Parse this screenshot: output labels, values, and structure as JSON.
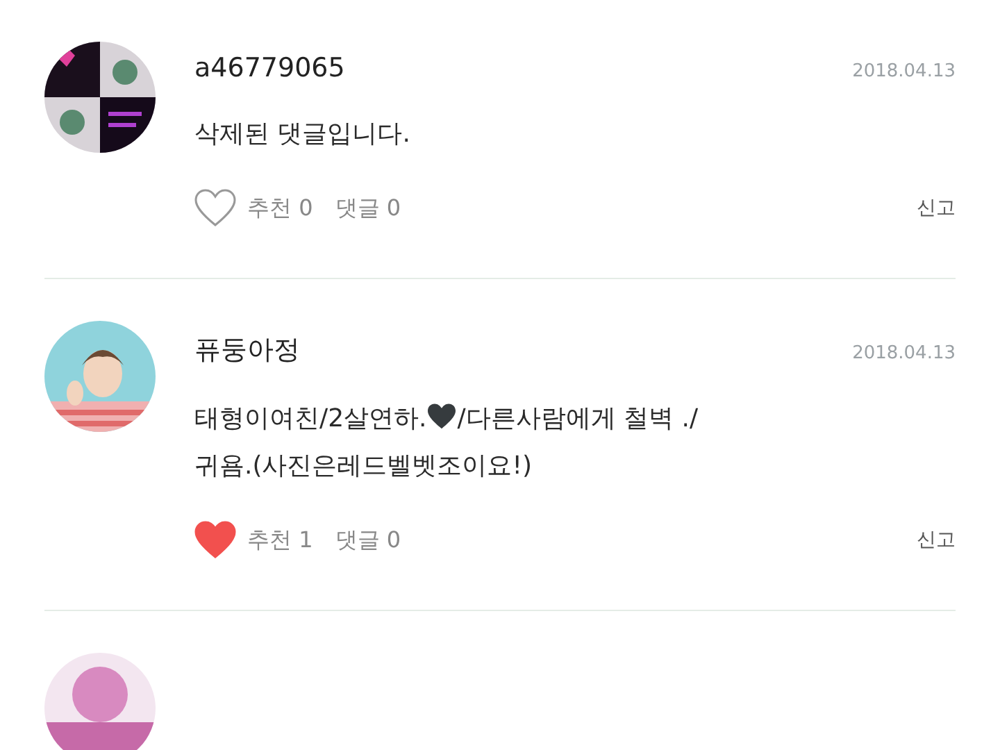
{
  "comments": [
    {
      "author": "a46779065",
      "date": "2018.04.13",
      "avatar": {
        "kind": "picture"
      },
      "lines": [
        [
          {
            "kind": "text",
            "text": "삭제된 댓글입니다."
          }
        ]
      ],
      "liked": false,
      "like_label": "추천",
      "like_count": "0",
      "reply_label": "댓글",
      "reply_count": "0",
      "report": "신고"
    },
    {
      "author": "퓨둥아정",
      "date": "2018.04.13",
      "avatar": {
        "kind": "picture"
      },
      "lines": [
        [
          {
            "kind": "text",
            "text": "태형이여친/2살연하."
          },
          {
            "kind": "heart",
            "color": "#363b3e"
          },
          {
            "kind": "text",
            "text": "/다른사람에게 철벽 ./"
          }
        ],
        [
          {
            "kind": "text",
            "text": "귀욤.(사진은레드벨벳조이요!)"
          }
        ]
      ],
      "liked": true,
      "like_label": "추천",
      "like_count": "1",
      "reply_label": "댓글",
      "reply_count": "0",
      "report": "신고"
    },
    {
      "avatar": {
        "kind": "picture"
      }
    }
  ]
}
